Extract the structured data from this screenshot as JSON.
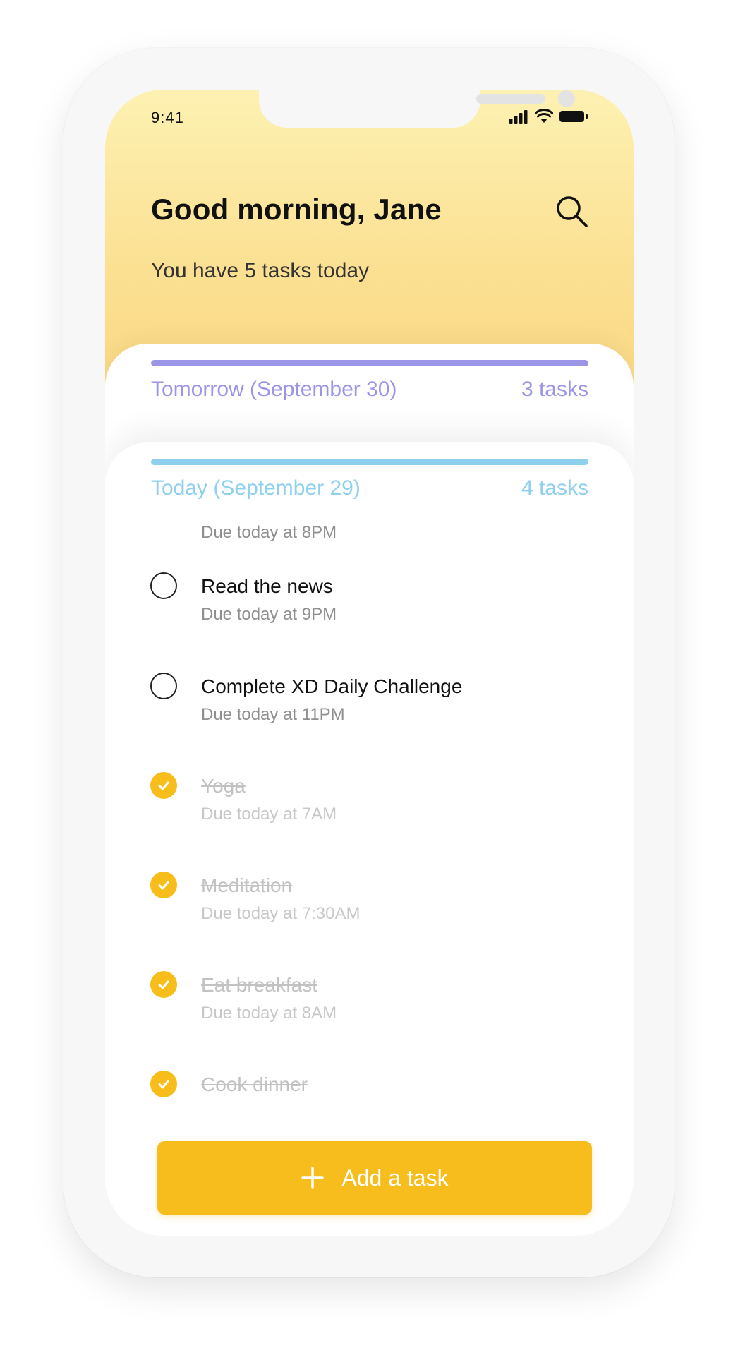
{
  "status_bar": {
    "time": "9:41"
  },
  "header": {
    "greeting": "Good morning, Jane",
    "subtitle": "You have 5 tasks today"
  },
  "sections": {
    "tomorrow": {
      "title": "Tomorrow (September 30)",
      "count": "3 tasks",
      "color": "#9b95e8"
    },
    "today": {
      "title": "Today (September 29)",
      "count": "4 tasks",
      "color": "#8fd0ef"
    }
  },
  "tasks": [
    {
      "title": "",
      "due": "Due today at 8PM",
      "done": false,
      "partial": true
    },
    {
      "title": "Read the news",
      "due": "Due today at 9PM",
      "done": false
    },
    {
      "title": "Complete XD Daily Challenge",
      "due": "Due today at 11PM",
      "done": false
    },
    {
      "title": "Yoga",
      "due": "Due today at 7AM",
      "done": true
    },
    {
      "title": "Meditation",
      "due": "Due today at 7:30AM",
      "done": true
    },
    {
      "title": "Eat breakfast",
      "due": "Due today at 8AM",
      "done": true
    },
    {
      "title": "Cook dinner",
      "due": "",
      "done": true
    }
  ],
  "footer": {
    "add_label": "Add a task"
  },
  "colors": {
    "accent": "#f6bd1c",
    "header_top": "#fdf1b2",
    "header_bottom": "#f9cf74"
  },
  "icons": {
    "search": "search-icon",
    "plus": "plus-icon",
    "check": "check-icon"
  }
}
